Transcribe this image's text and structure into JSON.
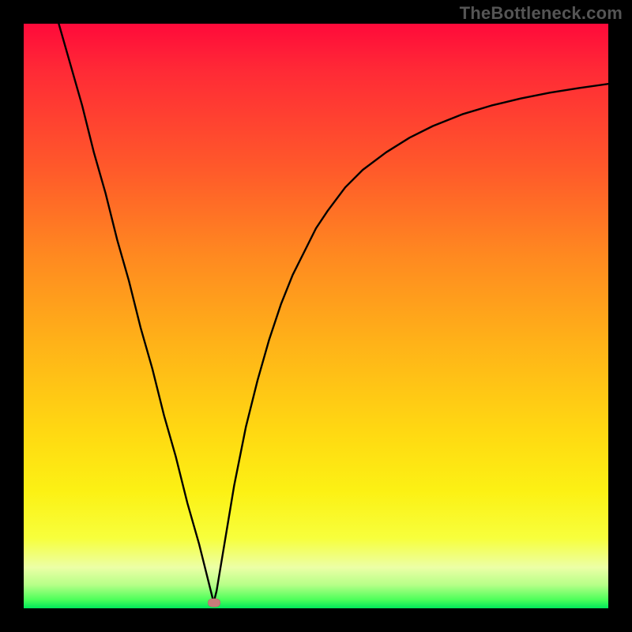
{
  "watermark": "TheBottleneck.com",
  "colors": {
    "frame": "#000000",
    "curve": "#000000",
    "marker": "#c97c7a",
    "gradient_top": "#ff0a3a",
    "gradient_bottom": "#00e85a"
  },
  "chart_data": {
    "type": "line",
    "title": "",
    "xlabel": "",
    "ylabel": "",
    "xlim": [
      0,
      100
    ],
    "ylim": [
      0,
      100
    ],
    "grid": false,
    "legend": false,
    "marker": {
      "x": 32.5,
      "y": 1.0
    },
    "series": [
      {
        "name": "curve",
        "x": [
          6,
          8,
          10,
          12,
          14,
          16,
          18,
          20,
          22,
          24,
          26,
          28,
          30,
          32,
          32.5,
          33,
          34,
          35,
          36,
          38,
          40,
          42,
          44,
          46,
          48,
          50,
          52,
          55,
          58,
          62,
          66,
          70,
          75,
          80,
          85,
          90,
          95,
          100
        ],
        "y": [
          100,
          93,
          86,
          78,
          71,
          63,
          56,
          48,
          41,
          33,
          26,
          18,
          11,
          3,
          1,
          3,
          9,
          15,
          21,
          31,
          39,
          46,
          52,
          57,
          61,
          65,
          68,
          72,
          75,
          78,
          80.5,
          82.5,
          84.5,
          86,
          87.2,
          88.2,
          89,
          89.7
        ]
      }
    ]
  }
}
